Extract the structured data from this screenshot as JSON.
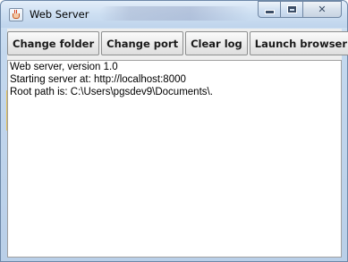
{
  "window": {
    "title": "Web Server",
    "icon": "java-cup-icon",
    "caption_buttons": {
      "minimize": "minimize-icon",
      "maximize": "maximize-icon",
      "close": "✕"
    }
  },
  "toolbar": {
    "buttons": [
      {
        "label": "Change folder"
      },
      {
        "label": "Change port"
      },
      {
        "label": "Clear log"
      },
      {
        "label": "Launch browser"
      }
    ]
  },
  "log": {
    "lines": [
      "Web server, version 1.0",
      "Starting server at: http://localhost:8000",
      "Root path is: C:\\Users\\pgsdev9\\Documents\\."
    ]
  }
}
